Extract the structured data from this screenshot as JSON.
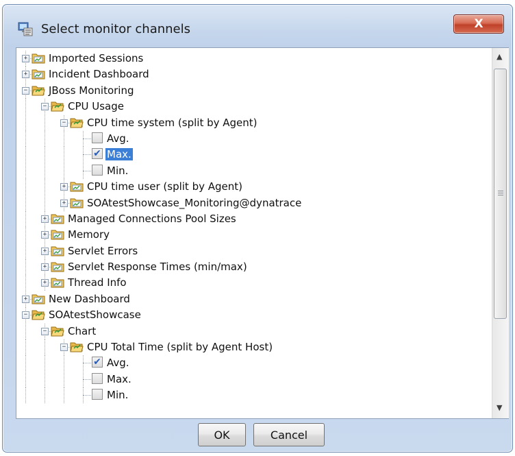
{
  "window": {
    "title": "Select monitor channels",
    "close_label": "X"
  },
  "tree": [
    {
      "label": "Imported Sessions",
      "level": 0,
      "kind": "folder",
      "expander": "+"
    },
    {
      "label": "Incident Dashboard",
      "level": 0,
      "kind": "folder",
      "expander": "+"
    },
    {
      "label": "JBoss Monitoring",
      "level": 0,
      "kind": "folder",
      "expander": "−",
      "open": true
    },
    {
      "label": "CPU Usage",
      "level": 1,
      "kind": "folder",
      "expander": "−",
      "open": true
    },
    {
      "label": "CPU time system (split by Agent)",
      "level": 2,
      "kind": "folder",
      "expander": "−",
      "open": true
    },
    {
      "label": "Avg.",
      "level": 3,
      "kind": "check",
      "checked": false
    },
    {
      "label": "Max.",
      "level": 3,
      "kind": "check",
      "checked": true,
      "selected": true
    },
    {
      "label": "Min.",
      "level": 3,
      "kind": "check",
      "checked": false
    },
    {
      "label": "CPU time user (split by Agent)",
      "level": 2,
      "kind": "folder",
      "expander": "+"
    },
    {
      "label": "SOAtestShowcase_Monitoring@dynatrace",
      "level": 2,
      "kind": "folder",
      "expander": "+"
    },
    {
      "label": "Managed Connections Pool Sizes",
      "level": 1,
      "kind": "folder",
      "expander": "+"
    },
    {
      "label": "Memory",
      "level": 1,
      "kind": "folder",
      "expander": "+"
    },
    {
      "label": "Servlet Errors",
      "level": 1,
      "kind": "folder",
      "expander": "+"
    },
    {
      "label": "Servlet Response Times (min/max)",
      "level": 1,
      "kind": "folder",
      "expander": "+"
    },
    {
      "label": "Thread Info",
      "level": 1,
      "kind": "folder",
      "expander": "+"
    },
    {
      "label": "New Dashboard",
      "level": 0,
      "kind": "folder",
      "expander": "+"
    },
    {
      "label": "SOAtestShowcase",
      "level": 0,
      "kind": "folder",
      "expander": "−",
      "open": true
    },
    {
      "label": "Chart",
      "level": 1,
      "kind": "folder",
      "expander": "−",
      "open": true
    },
    {
      "label": "CPU Total Time (split by Agent Host)",
      "level": 2,
      "kind": "folder",
      "expander": "−",
      "open": true
    },
    {
      "label": "Avg.",
      "level": 3,
      "kind": "check",
      "checked": true
    },
    {
      "label": "Max.",
      "level": 3,
      "kind": "check",
      "checked": false
    },
    {
      "label": "Min.",
      "level": 3,
      "kind": "check",
      "checked": false
    }
  ],
  "scrollbar": {
    "up_arrow": "▲",
    "down_arrow": "▼"
  },
  "buttons": {
    "ok": "OK",
    "cancel": "Cancel"
  },
  "colors": {
    "selection": "#3c7fd6",
    "close_button": "#c0412a",
    "window_frame": "#c5d6ec"
  }
}
